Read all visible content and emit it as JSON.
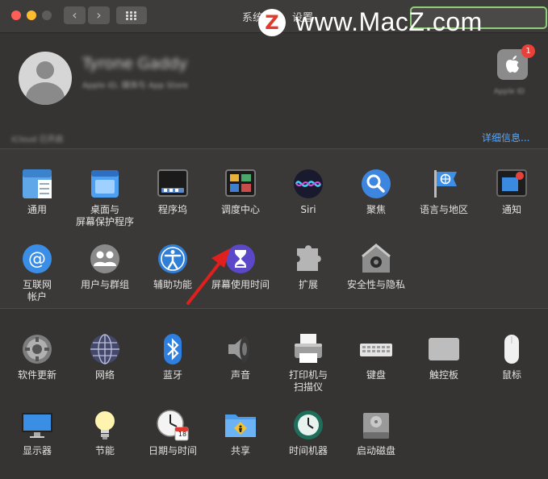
{
  "window": {
    "title_left": "系统",
    "title_right": "设置",
    "nav_back_glyph": "‹",
    "nav_forward_glyph": "›"
  },
  "watermark": {
    "badge": "Z",
    "text": "www.MacZ.com"
  },
  "profile": {
    "name": "Tyrone Gaddy",
    "subtitle": "Apple ID, 媒体与 App Store",
    "apple_id_label": "Apple ID",
    "badge_count": "1",
    "icloud_text": "iCloud 已开启",
    "details_link": "详细信息..."
  },
  "colors": {
    "link": "#56a7ff",
    "badge": "#e8413a",
    "arrow": "#e0201c"
  },
  "panes_row1": [
    {
      "id": "general",
      "label": "通用",
      "icon": "general-icon"
    },
    {
      "id": "desktop",
      "label": "桌面与\n屏幕保护程序",
      "icon": "desktop-screensaver-icon"
    },
    {
      "id": "dock",
      "label": "程序坞",
      "icon": "dock-icon"
    },
    {
      "id": "mission",
      "label": "调度中心",
      "icon": "mission-control-icon"
    },
    {
      "id": "siri",
      "label": "Siri",
      "icon": "siri-icon"
    },
    {
      "id": "spotlight",
      "label": "聚焦",
      "icon": "spotlight-icon"
    },
    {
      "id": "language",
      "label": "语言与地区",
      "icon": "language-region-icon"
    },
    {
      "id": "notifications",
      "label": "通知",
      "icon": "notifications-icon"
    }
  ],
  "panes_row2": [
    {
      "id": "internet",
      "label": "互联网\n帐户",
      "icon": "internet-accounts-icon"
    },
    {
      "id": "users",
      "label": "用户与群组",
      "icon": "users-groups-icon"
    },
    {
      "id": "accessibility",
      "label": "辅助功能",
      "icon": "accessibility-icon"
    },
    {
      "id": "screentime",
      "label": "屏幕使用时间",
      "icon": "screen-time-icon"
    },
    {
      "id": "extensions",
      "label": "扩展",
      "icon": "extensions-icon"
    },
    {
      "id": "security",
      "label": "安全性与隐私",
      "icon": "security-privacy-icon"
    }
  ],
  "panes_row3": [
    {
      "id": "update",
      "label": "软件更新",
      "icon": "software-update-icon"
    },
    {
      "id": "network",
      "label": "网络",
      "icon": "network-icon"
    },
    {
      "id": "bluetooth",
      "label": "蓝牙",
      "icon": "bluetooth-icon"
    },
    {
      "id": "sound",
      "label": "声音",
      "icon": "sound-icon"
    },
    {
      "id": "printers",
      "label": "打印机与\n扫描仪",
      "icon": "printers-scanners-icon"
    },
    {
      "id": "keyboard",
      "label": "键盘",
      "icon": "keyboard-icon"
    },
    {
      "id": "trackpad",
      "label": "触控板",
      "icon": "trackpad-icon"
    },
    {
      "id": "mouse",
      "label": "鼠标",
      "icon": "mouse-icon"
    }
  ],
  "panes_row4": [
    {
      "id": "displays",
      "label": "显示器",
      "icon": "displays-icon"
    },
    {
      "id": "energy",
      "label": "节能",
      "icon": "energy-saver-icon"
    },
    {
      "id": "datetime",
      "label": "日期与时间",
      "icon": "date-time-icon",
      "date_number": "18"
    },
    {
      "id": "sharing",
      "label": "共享",
      "icon": "sharing-icon"
    },
    {
      "id": "timemachine",
      "label": "时间机器",
      "icon": "time-machine-icon"
    },
    {
      "id": "startup",
      "label": "启动磁盘",
      "icon": "startup-disk-icon"
    }
  ]
}
